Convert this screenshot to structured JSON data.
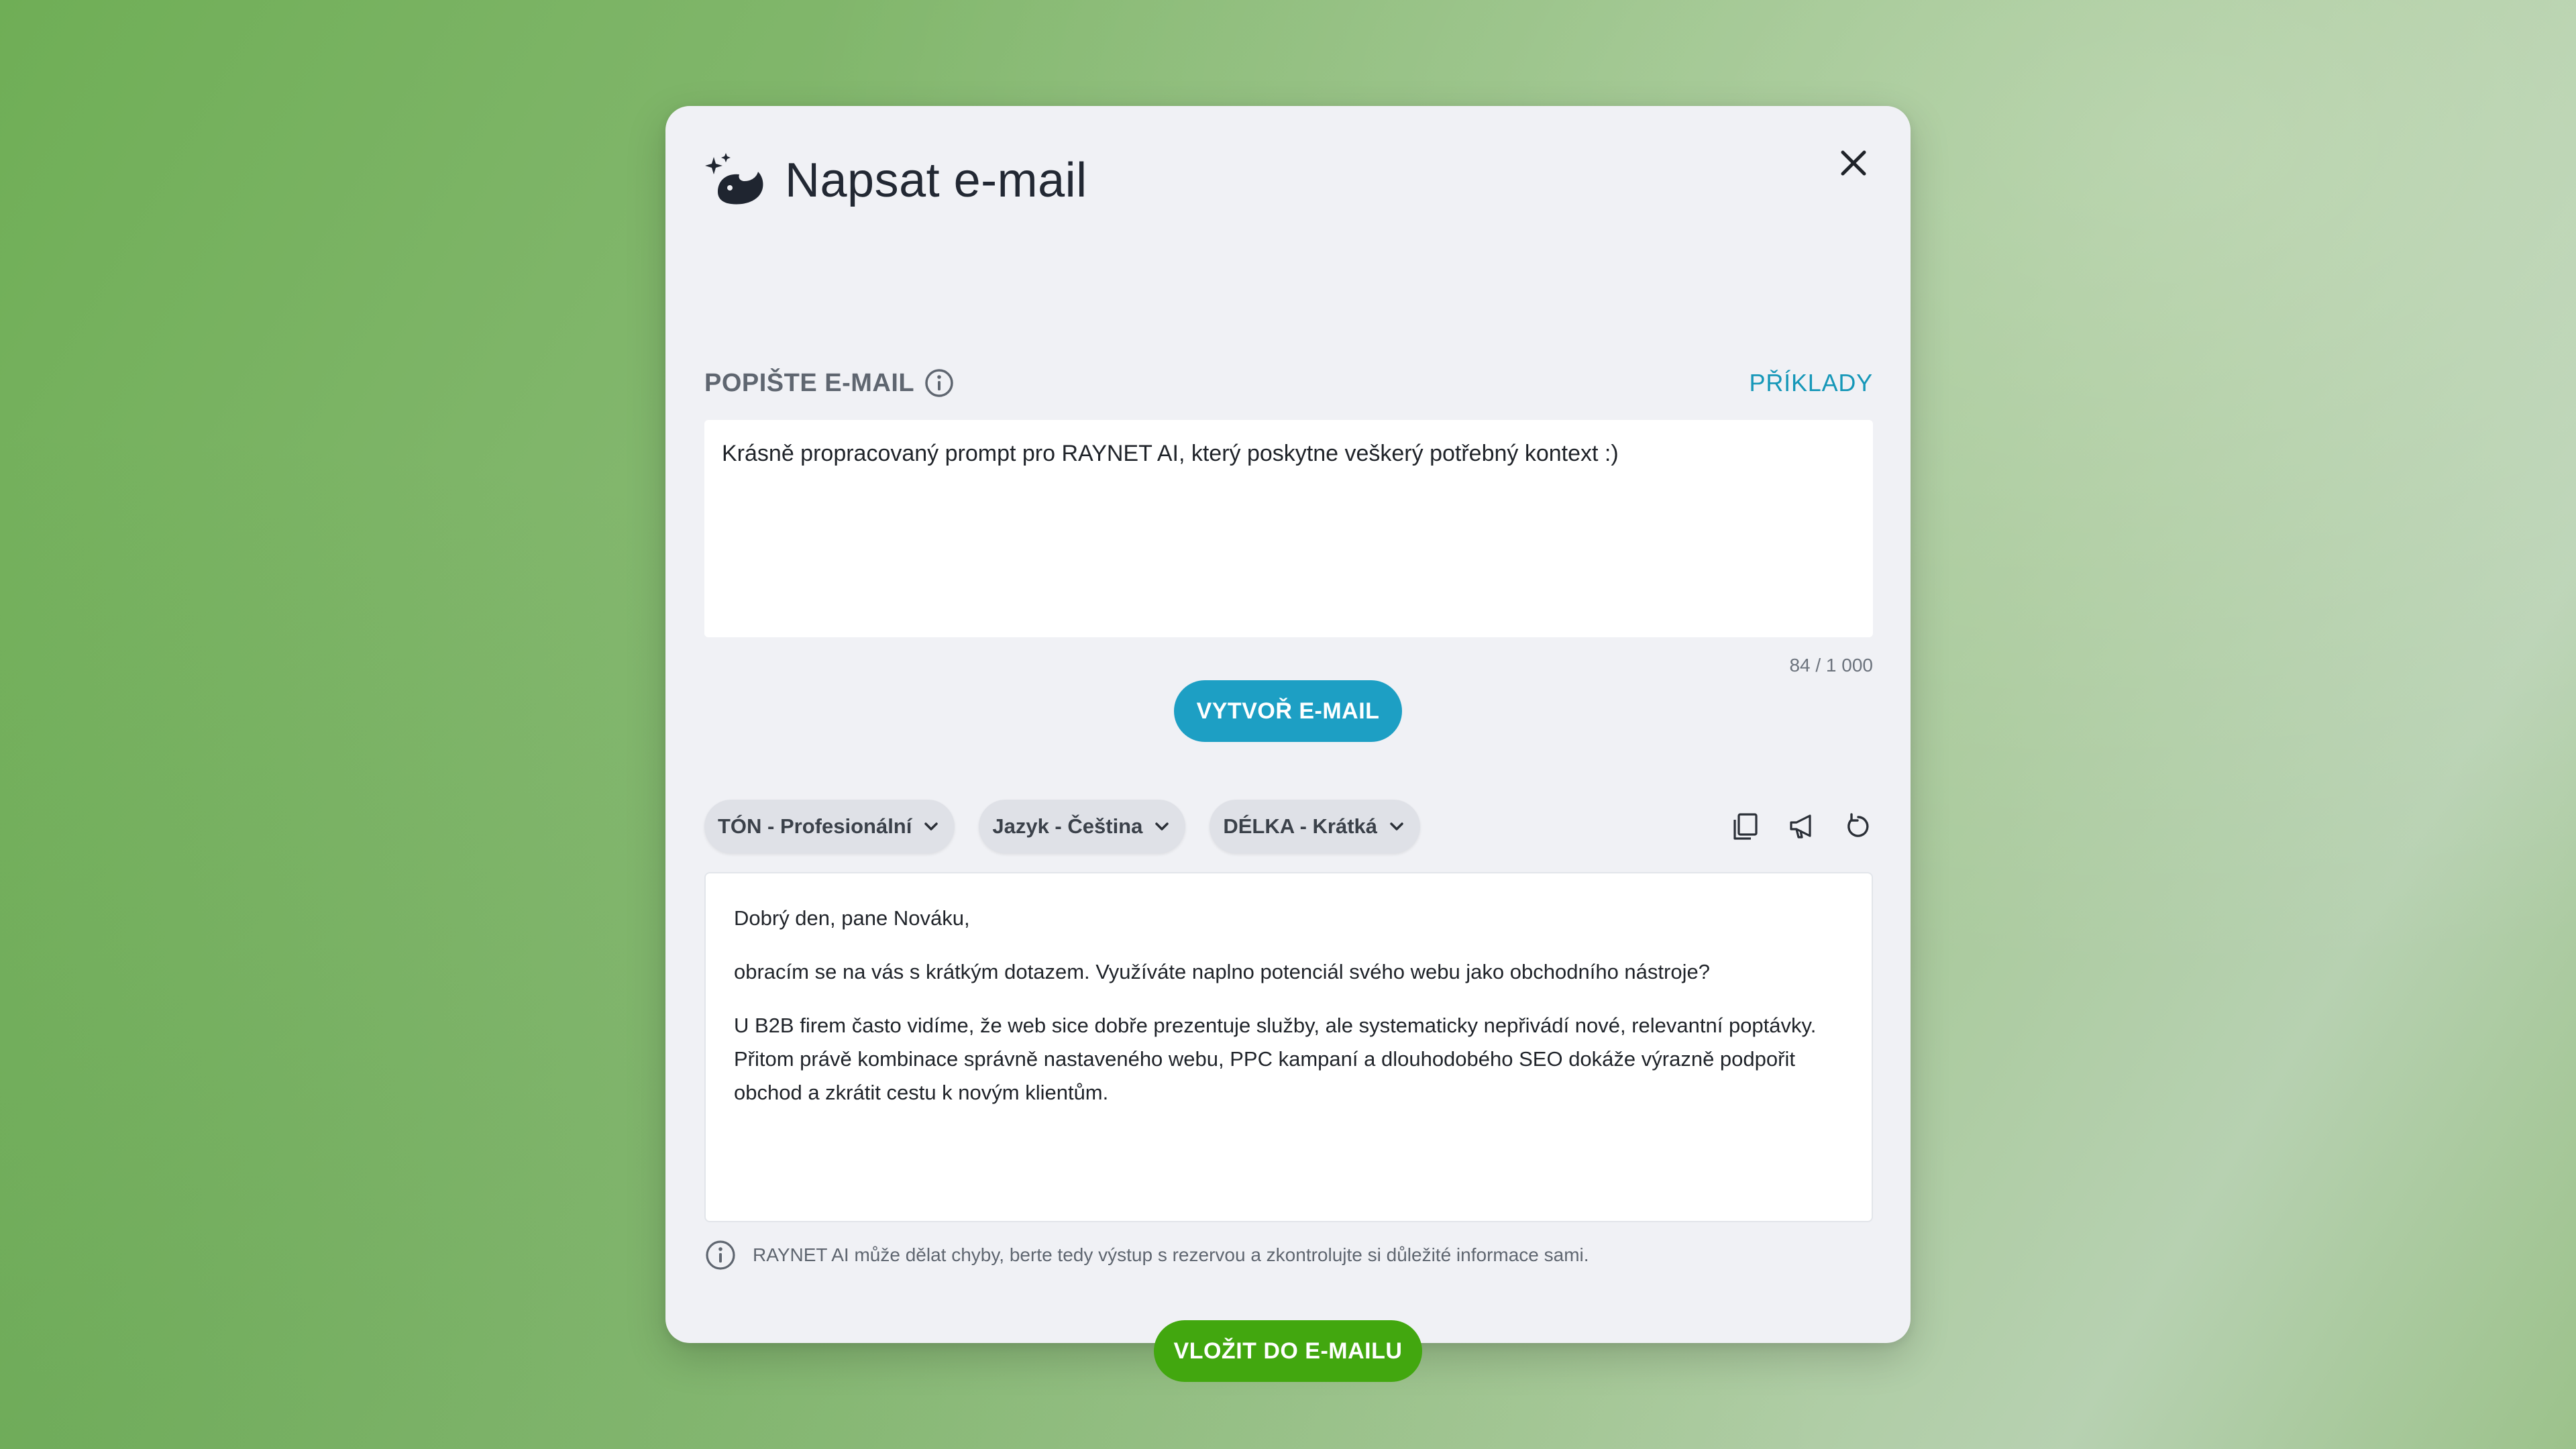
{
  "dialog": {
    "title": "Napsat e-mail",
    "title_icon": "ai-sparkles-icon",
    "close_icon": "close-icon"
  },
  "prompt_section": {
    "label": "POPIŠTE E-MAIL",
    "info_icon": "info-icon",
    "examples_link": "PŘÍKLADY",
    "text": "Krásně propracovaný prompt pro RAYNET AI, který poskytne veškerý potřebný kontext :)",
    "counter": "84 / 1 000"
  },
  "create_button": {
    "label": "VYTVOŘ E-MAIL"
  },
  "options": {
    "tone": "TÓN - Profesionální",
    "language": "Jazyk - Čeština",
    "length": "DÉLKA - Krátká",
    "tools": [
      "copy-icon",
      "megaphone-icon",
      "refresh-icon"
    ]
  },
  "output": {
    "greeting": "Dobrý den, pane Nováku,",
    "paragraph_1": "obracím se na vás s krátkým dotazem. Využíváte naplno potenciál svého webu jako obchodního nástroje?",
    "paragraph_2_line_1": "U B2B firem často vidíme, že web sice dobře prezentuje služby, ale systematicky nepřivádí nové, relevantní poptávky.",
    "paragraph_2_line_2": "Přitom právě kombinace správně nastaveného webu, PPC kampaní a dlouhodobého SEO dokáže výrazně podpořit",
    "paragraph_2_line_3": "obchod a zkrátit cestu k novým klientům."
  },
  "disclaimer": {
    "icon": "info-icon",
    "text": "RAYNET AI může dělat chyby, berte tedy výstup s rezervou a zkontrolujte si důležité informace sami."
  },
  "insert_button": {
    "label": "VLOŽIT DO E-MAILU"
  },
  "colors": {
    "accent_blue": "#1d9fc4",
    "accent_green": "#42a70f",
    "modal_bg": "#f0f1f5"
  }
}
